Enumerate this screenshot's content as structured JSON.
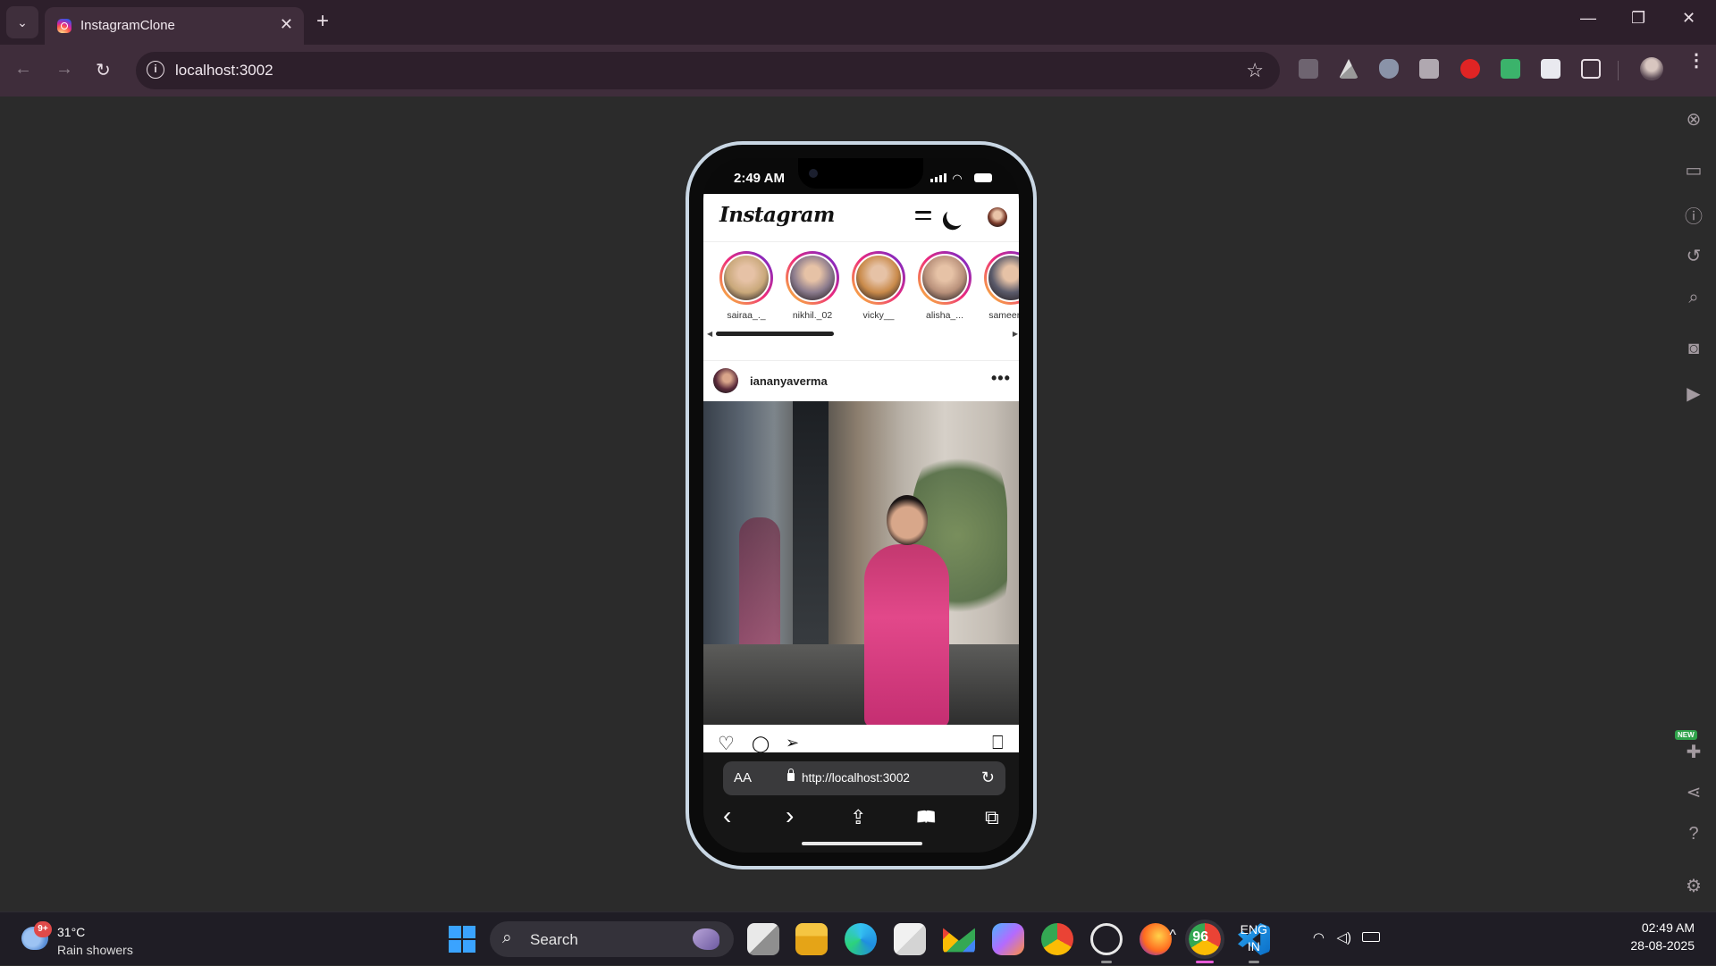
{
  "browser": {
    "tab_list_glyph": "⌄",
    "tab_title": "InstagramClone",
    "tab_close": "✕",
    "new_tab": "+",
    "window": {
      "minimize": "—",
      "restore": "❐",
      "close": "✕"
    },
    "nav": {
      "back": "←",
      "forward": "→",
      "reload": "↻"
    },
    "address": "localhost:3002",
    "bookmark_glyph": "☆",
    "menu_glyph": "⋮"
  },
  "device_panel": {
    "icons": [
      "close-icon",
      "devices-icon",
      "info-icon",
      "rotate-icon",
      "zoom-icon",
      "screenshot-icon",
      "record-icon",
      "extensions-icon",
      "share-icon",
      "help-icon",
      "settings-icon"
    ],
    "new_badge": "NEW"
  },
  "phone": {
    "status_time": "2:49 AM",
    "app": {
      "logo": "Instagram",
      "stories": [
        {
          "username": "sairaa_._",
          "color": "#c9a87a"
        },
        {
          "username": "nikhil._02",
          "color": "#8a7a8c"
        },
        {
          "username": "vicky__",
          "color": "#c98a4a"
        },
        {
          "username": "alisha_...",
          "color": "#b8907a"
        },
        {
          "username": "sameer_...",
          "color": "#5a5a6a"
        }
      ],
      "post": {
        "username": "iananyaverma",
        "more": "•••"
      },
      "actions": {
        "like": "♡",
        "comment": "◯",
        "share": "➢",
        "save": "⎕"
      }
    },
    "safari": {
      "text_size": "AA",
      "url": "http://localhost:3002",
      "reload": "↻",
      "back": "‹",
      "forward": "›",
      "share": "⇪",
      "bookmarks": "📖",
      "tabs": "⧉"
    }
  },
  "taskbar": {
    "weather": {
      "badge": "9+",
      "temp": "31°C",
      "condition": "Rain showers"
    },
    "search_label": "Search",
    "tray": {
      "chevron": "^",
      "count": "96",
      "lang": "ENG",
      "region": "IN",
      "time": "02:49 AM",
      "date": "28-08-2025"
    }
  }
}
